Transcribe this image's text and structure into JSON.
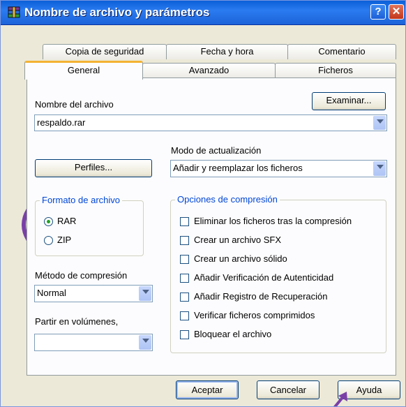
{
  "window": {
    "title": "Nombre de archivo y parámetros",
    "help_glyph": "?",
    "close_glyph": "✕"
  },
  "tabs_back": [
    "Copia de seguridad",
    "Fecha y hora",
    "Comentario"
  ],
  "tabs_front": [
    "General",
    "Avanzado",
    "Ficheros"
  ],
  "active_tab": "General",
  "filename": {
    "label": "Nombre del archivo",
    "value": "respaldo.rar",
    "browse_button": "Examinar..."
  },
  "profiles_button": "Perfiles...",
  "update_mode": {
    "label": "Modo de actualización",
    "value": "Añadir y reemplazar los ficheros"
  },
  "archive_format": {
    "title": "Formato de archivo",
    "options": [
      "RAR",
      "ZIP"
    ],
    "selected": "RAR"
  },
  "compression_method": {
    "label": "Método de compresión",
    "value": "Normal"
  },
  "split_volumes": {
    "label": "Partir en volúmenes,",
    "value": ""
  },
  "compression_options": {
    "title": "Opciones de compresión",
    "items": [
      "Eliminar los ficheros tras la compresión",
      "Crear un archivo SFX",
      "Crear un archivo sólido",
      "Añadir Verificación de Autenticidad",
      "Añadir Registro de Recuperación",
      "Verificar ficheros comprimidos",
      "Bloquear el archivo"
    ]
  },
  "buttons": {
    "ok": "Aceptar",
    "cancel": "Cancelar",
    "help": "Ayuda"
  },
  "colors": {
    "annotation": "#7a3fa7",
    "group_title": "#0046d5",
    "tab_highlight": "#f4b233"
  }
}
